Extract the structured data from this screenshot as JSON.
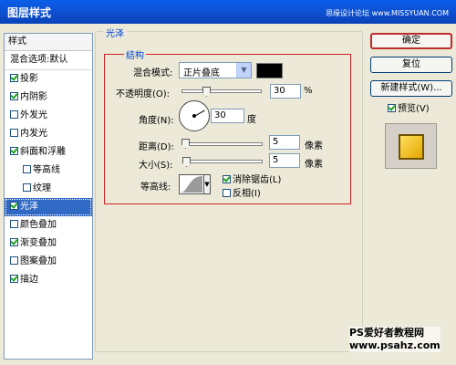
{
  "window": {
    "title": "图层样式",
    "watermark": "思缘设计论坛 www.MISSYUAN.COM"
  },
  "style_list": {
    "header": "样式",
    "items": [
      {
        "label": "混合选项:默认",
        "checkbox": false,
        "checked": false
      },
      {
        "label": "投影",
        "checkbox": true,
        "checked": true
      },
      {
        "label": "内阴影",
        "checkbox": true,
        "checked": true
      },
      {
        "label": "外发光",
        "checkbox": true,
        "checked": false
      },
      {
        "label": "内发光",
        "checkbox": true,
        "checked": false
      },
      {
        "label": "斜面和浮雕",
        "checkbox": true,
        "checked": true
      },
      {
        "label": "等高线",
        "checkbox": true,
        "checked": false
      },
      {
        "label": "纹理",
        "checkbox": true,
        "checked": false
      },
      {
        "label": "光泽",
        "checkbox": true,
        "checked": true,
        "selected": true
      },
      {
        "label": "颜色叠加",
        "checkbox": true,
        "checked": false
      },
      {
        "label": "渐变叠加",
        "checkbox": true,
        "checked": true
      },
      {
        "label": "图案叠加",
        "checkbox": true,
        "checked": false
      },
      {
        "label": "描边",
        "checkbox": true,
        "checked": true
      }
    ]
  },
  "panel": {
    "title": "光泽",
    "structure": "结构",
    "blend_mode_label": "混合模式:",
    "blend_mode_value": "正片叠底",
    "blend_color": "#000000",
    "opacity_label": "不透明度(O):",
    "opacity_value": "30",
    "opacity_unit": "%",
    "angle_label": "角度(N):",
    "angle_value": "30",
    "angle_unit": "度",
    "distance_label": "距离(D):",
    "distance_value": "5",
    "distance_unit": "像素",
    "size_label": "大小(S):",
    "size_value": "5",
    "size_unit": "像素",
    "contour_label": "等高线:",
    "antialias_label": "消除锯齿(L)",
    "antialias_checked": true,
    "invert_label": "反相(I)",
    "invert_checked": false
  },
  "buttons": {
    "ok": "确定",
    "reset": "复位",
    "new_style": "新建样式(W)...",
    "preview_label": "预览(V)",
    "preview_checked": true
  },
  "watermark": {
    "line1": "PS爱好者教程网",
    "line2": "www.psahz.com"
  }
}
